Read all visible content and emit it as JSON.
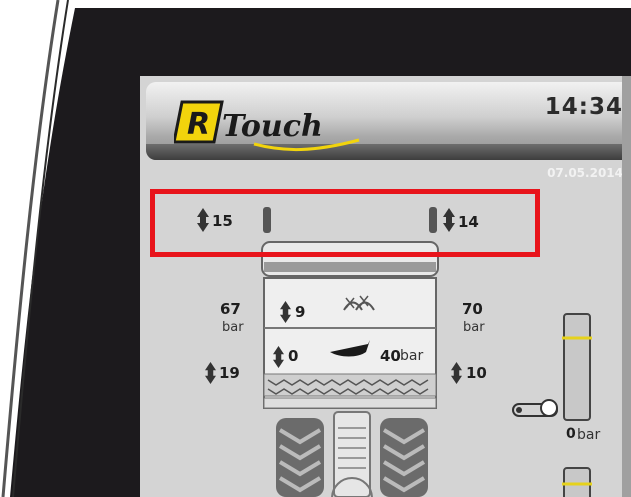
{
  "header": {
    "logo_letter": "R",
    "logo_text": "Touch",
    "clock": "14:34",
    "date": "07.05.2014"
  },
  "highlight": {
    "left_value": "15",
    "right_value": "14"
  },
  "readings": {
    "left_pressure": "67",
    "left_unit": "bar",
    "right_pressure": "70",
    "right_unit": "bar",
    "row1_value": "9",
    "row2_value": "0",
    "row2_pressure": "40",
    "row2_unit": "bar",
    "left_lower": "19",
    "right_lower": "10",
    "drive_pressure": "0",
    "drive_unit": "bar"
  },
  "colors": {
    "bezel": "#1c1a1d",
    "highlight": "#e8141b",
    "logo_yellow": "#f2d40c",
    "indicator_yellow": "#e6d21c"
  }
}
